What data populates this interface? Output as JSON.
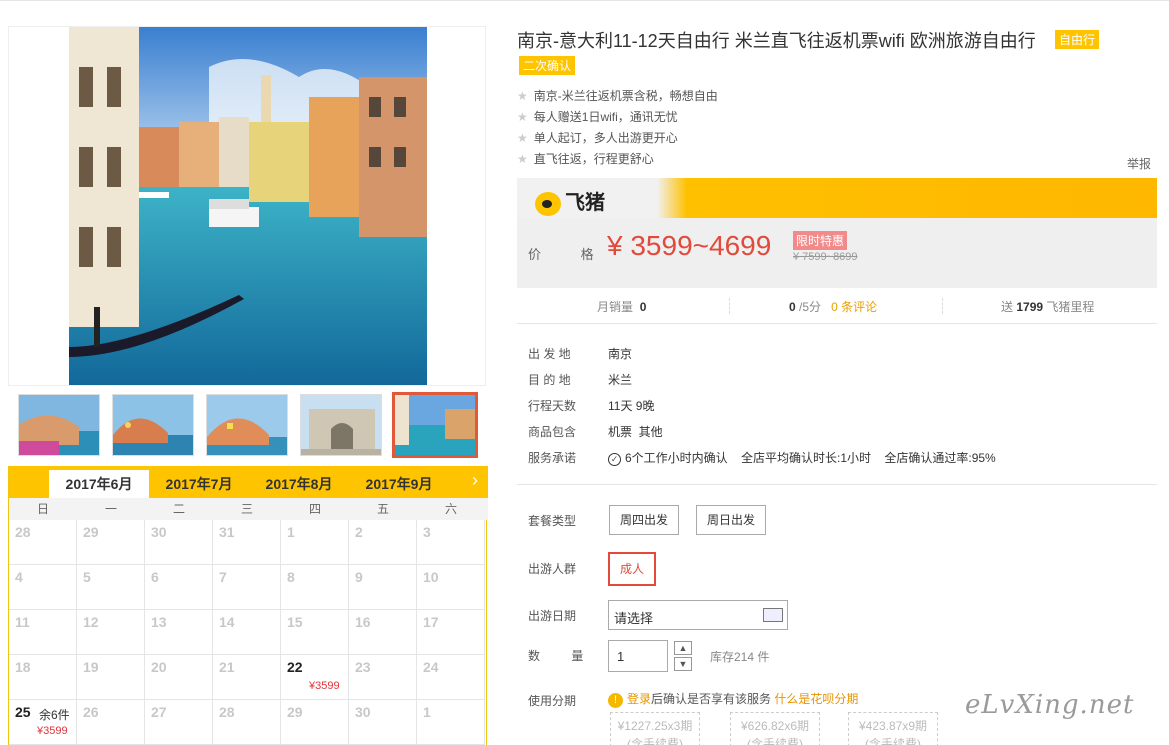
{
  "product": {
    "title": "南京-意大利11-12天自由行 米兰直飞往返机票wifi 欧洲旅游自由行",
    "tag_type": "自由行",
    "tag_confirm": "二次确认",
    "features": [
      "南京-米兰往返机票含税，畅想自由",
      "每人赠送1日wifi，通讯无忧",
      "单人起订，多人出游更开心",
      "直飞往返，行程更舒心"
    ],
    "report": "举报"
  },
  "price_box": {
    "brand": "飞猪",
    "price_label": "价 格",
    "price": "¥ 3599~4699",
    "promo_tag": "限时特惠",
    "original_price": "¥ 7599~8699"
  },
  "stats": {
    "monthly_sales_label": "月销量",
    "monthly_sales": "0",
    "score": "0",
    "score_unit": "/5分",
    "reviews": "0 条评论",
    "mileage_prefix": "送",
    "mileage": "1799",
    "mileage_suffix": "飞猪里程"
  },
  "info": {
    "departure_label": "出 发 地",
    "departure": "南京",
    "destination_label": "目 的 地",
    "destination": "米兰",
    "days_label": "行程天数",
    "days": "11天 9晚",
    "includes_label": "商品包含",
    "includes": "机票  其他",
    "promise_label": "服务承诺",
    "promise": "6个工作小时内确认    全店平均确认时长:1小时    全店确认通过率:95%"
  },
  "options": {
    "package_label": "套餐类型",
    "packages": [
      "周四出发",
      "周日出发"
    ],
    "crowd_label": "出游人群",
    "crowd": "成人",
    "date_label": "出游日期",
    "date_value": "请选择",
    "qty_label": "数 量",
    "qty_value": "1",
    "stock": "库存214 件",
    "installment_label": "使用分期",
    "installment_login": "登录",
    "installment_text": "后确认是否享有该服务",
    "installment_link": "什么是花呗分期",
    "installments": [
      {
        "amount": "¥1227.25x3期",
        "note": "(含手续费)"
      },
      {
        "amount": "¥626.82x6期",
        "note": "(含手续费)"
      },
      {
        "amount": "¥423.87x9期",
        "note": "(含手续费)"
      }
    ]
  },
  "calendar": {
    "months": [
      "2017年6月",
      "2017年7月",
      "2017年8月",
      "2017年9月"
    ],
    "next": "›",
    "weekdays": [
      "日",
      "一",
      "二",
      "三",
      "四",
      "五",
      "六"
    ],
    "rows": [
      [
        "28",
        "29",
        "30",
        "31",
        "1",
        "2",
        "3"
      ],
      [
        "4",
        "5",
        "6",
        "7",
        "8",
        "9",
        "10"
      ],
      [
        "11",
        "12",
        "13",
        "14",
        "15",
        "16",
        "17"
      ],
      [
        "18",
        "19",
        "20",
        "21",
        "22",
        "23",
        "24"
      ],
      [
        "25",
        "26",
        "27",
        "28",
        "29",
        "30",
        "1"
      ]
    ],
    "price_22": "¥3599",
    "remaining_25": "余6件",
    "price_25": "¥3599"
  },
  "watermark": "eLvXing.net",
  "colors": {
    "accent": "#ffc400",
    "price": "#e24a3b",
    "selected": "#e05a3a"
  }
}
